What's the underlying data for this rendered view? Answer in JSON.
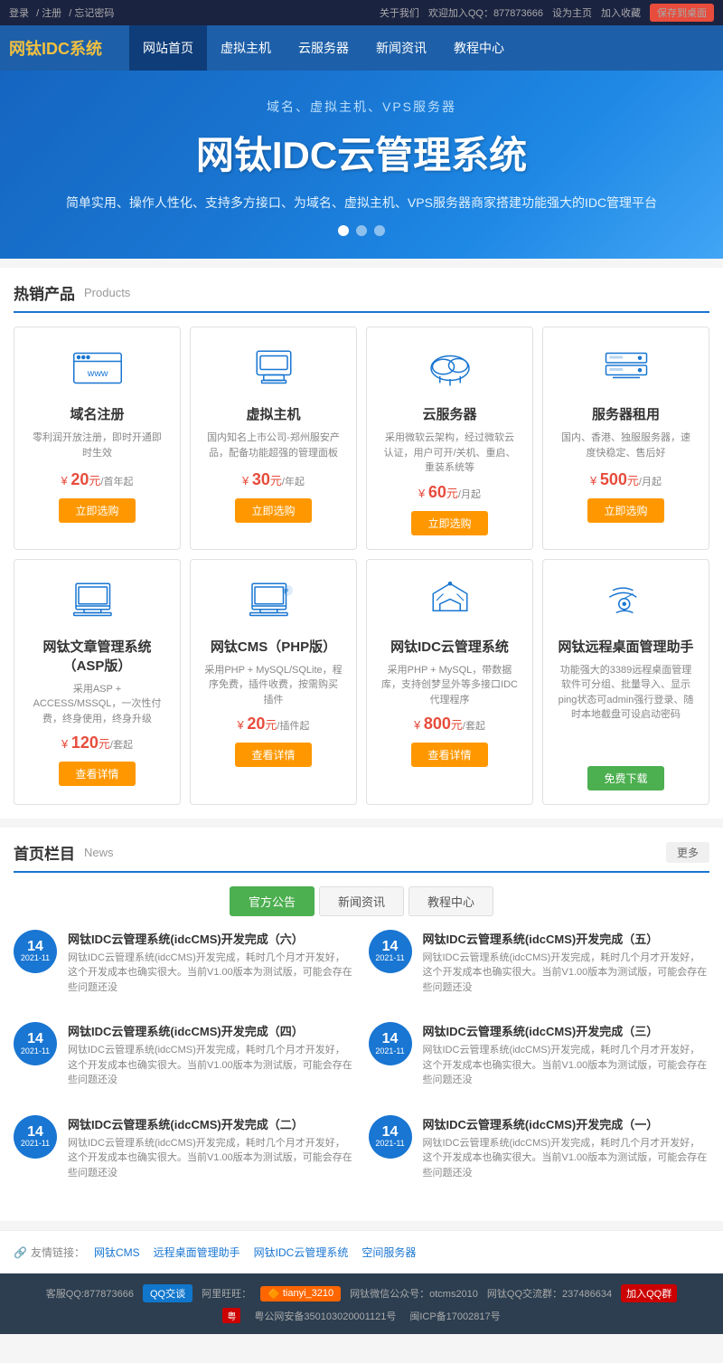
{
  "topbar": {
    "left": {
      "login": "登录",
      "register": "注册",
      "forgot": "忘记密码",
      "separator1": "/",
      "separator2": "/"
    },
    "right": {
      "about": "关于我们",
      "join_qq": "欢迎加入QQ：877873666",
      "set_home": "设为主页",
      "add_fav": "加入收藏",
      "save_desktop": "保存到桌面"
    }
  },
  "header": {
    "logo": "网钛IDC系统",
    "nav": [
      "网站首页",
      "虚拟主机",
      "云服务器",
      "新闻资讯",
      "教程中心"
    ]
  },
  "banner": {
    "subtitle": "域名、虚拟主机、VPS服务器",
    "title": "网钛IDC云管理系统",
    "desc": "简单实用、操作人性化、支持多方接口、为域名、虚拟主机、VPS服务器商家搭建功能强大的IDC管理平台"
  },
  "hot_products": {
    "title": "热销产品",
    "subtitle": "Products",
    "row1": [
      {
        "name": "域名注册",
        "desc": "零利润开放注册，即时开通即时生效",
        "price": "20",
        "unit": "元/首年起",
        "btn": "立即选购"
      },
      {
        "name": "虚拟主机",
        "desc": "国内知名上市公司-郑州服安产品，配备功能超强的管理面板",
        "price": "30",
        "unit": "元/年起",
        "btn": "立即选购"
      },
      {
        "name": "云服务器",
        "desc": "采用微软云架构，经过微软云认证，用户可开/关机、重启、重装系统等",
        "price": "60",
        "unit": "元/月起",
        "btn": "立即选购"
      },
      {
        "name": "服务器租用",
        "desc": "国内、香港、独服服务器，速度快稳定、售后好",
        "price": "500",
        "unit": "元/月起",
        "btn": "立即选购"
      }
    ],
    "row2": [
      {
        "name": "网钛文章管理系统（ASP版）",
        "desc": "采用ASP + ACCESS/MSSQL，一次性付费，终身使用，终身升级",
        "price": "120",
        "unit": "元/套起",
        "btn": "查看详情"
      },
      {
        "name": "网钛CMS（PHP版）",
        "desc": "采用PHP + MySQL/SQLite，程序免费，插件收费，按需购买插件",
        "price": "20",
        "unit": "元/插件起",
        "btn": "查看详情"
      },
      {
        "name": "网钛IDC云管理系统",
        "desc": "采用PHP + MySQL，带数据库，支持创梦显外等多接口IDC代理程序",
        "price": "800",
        "unit": "元/套起",
        "btn": "查看详情"
      },
      {
        "name": "网钛远程桌面管理助手",
        "desc": "功能强大的3389远程桌面管理软件可分组、批量导入、显示ping状态可admin强行登录、随时本地截盘可设启动密码",
        "price": "",
        "unit": "",
        "btn": "免费下载"
      }
    ]
  },
  "news": {
    "title": "首页栏目",
    "subtitle": "News",
    "more": "更多",
    "tabs": [
      "官方公告",
      "新闻资讯",
      "教程中心"
    ],
    "active_tab": 0,
    "items": [
      {
        "day": "14",
        "year_month": "2021-11",
        "title": "网钛IDC云管理系统(idcCMS)开发完成（六）",
        "excerpt": "网钛IDC云管理系统(idcCMS)开发完成，耗时几个月才开发好，这个开发成本也确实很大。当前V1.00版本为测试版，可能会存在些问题还没"
      },
      {
        "day": "14",
        "year_month": "2021-11",
        "title": "网钛IDC云管理系统(idcCMS)开发完成（五）",
        "excerpt": "网钛IDC云管理系统(idcCMS)开发完成，耗时几个月才开发好，这个开发成本也确实很大。当前V1.00版本为测试版，可能会存在些问题还没"
      },
      {
        "day": "14",
        "year_month": "2021-11",
        "title": "网钛IDC云管理系统(idcCMS)开发完成（四）",
        "excerpt": "网钛IDC云管理系统(idcCMS)开发完成，耗时几个月才开发好，这个开发成本也确实很大。当前V1.00版本为测试版，可能会存在些问题还没"
      },
      {
        "day": "14",
        "year_month": "2021-11",
        "title": "网钛IDC云管理系统(idcCMS)开发完成（三）",
        "excerpt": "网钛IDC云管理系统(idcCMS)开发完成，耗时几个月才开发好，这个开发成本也确实很大。当前V1.00版本为测试版，可能会存在些问题还没"
      },
      {
        "day": "14",
        "year_month": "2021-11",
        "title": "网钛IDC云管理系统(idcCMS)开发完成（二）",
        "excerpt": "网钛IDC云管理系统(idcCMS)开发完成，耗时几个月才开发好，这个开发成本也确实很大。当前V1.00版本为测试版，可能会存在些问题还没"
      },
      {
        "day": "14",
        "year_month": "2021-11",
        "title": "网钛IDC云管理系统(idcCMS)开发完成（一）",
        "excerpt": "网钛IDC云管理系统(idcCMS)开发完成，耗时几个月才开发好，这个开发成本也确实很大。当前V1.00版本为测试版，可能会存在些问题还没"
      }
    ]
  },
  "footer_links": {
    "label": "友情链接：",
    "links": [
      "网钛CMS",
      "远程桌面管理助手",
      "网钛IDC云管理系统",
      "空间服务器"
    ]
  },
  "bottom_bar": {
    "qq": "客服QQ:877873666",
    "qq_btn": "QQ交谈",
    "aliyun": "阿里旺旺：",
    "aliyun_name": "tianyi_3210",
    "wechat": "网钛微信公众号：otcms2010",
    "group": "网钛QQ交流群：237486634",
    "join_qq": "加入QQ群",
    "icp1": "粤公网安备350103020001121号",
    "icp2": "闽ICP备17002817号"
  }
}
